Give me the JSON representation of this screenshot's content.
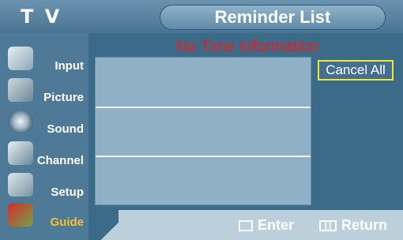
{
  "header": {
    "tv_label": "T V",
    "title": "Reminder List"
  },
  "sidebar": {
    "items": [
      {
        "label": "Input",
        "icon": "input-icon"
      },
      {
        "label": "Picture",
        "icon": "picture-icon"
      },
      {
        "label": "Sound",
        "icon": "sound-icon"
      },
      {
        "label": "Channel",
        "icon": "channel-icon"
      },
      {
        "label": "Setup",
        "icon": "setup-icon"
      },
      {
        "label": "Guide",
        "icon": "guide-icon",
        "active": true
      }
    ]
  },
  "main": {
    "message": "No Time Information",
    "cancel_all": "Cancel All",
    "rows": [
      "",
      "",
      ""
    ]
  },
  "footer": {
    "enter_label": "Enter",
    "return_label": "Return"
  },
  "colors": {
    "message": "#ee1c1c",
    "active_menu": "#f2c234",
    "focus_border": "#f4e23b"
  }
}
